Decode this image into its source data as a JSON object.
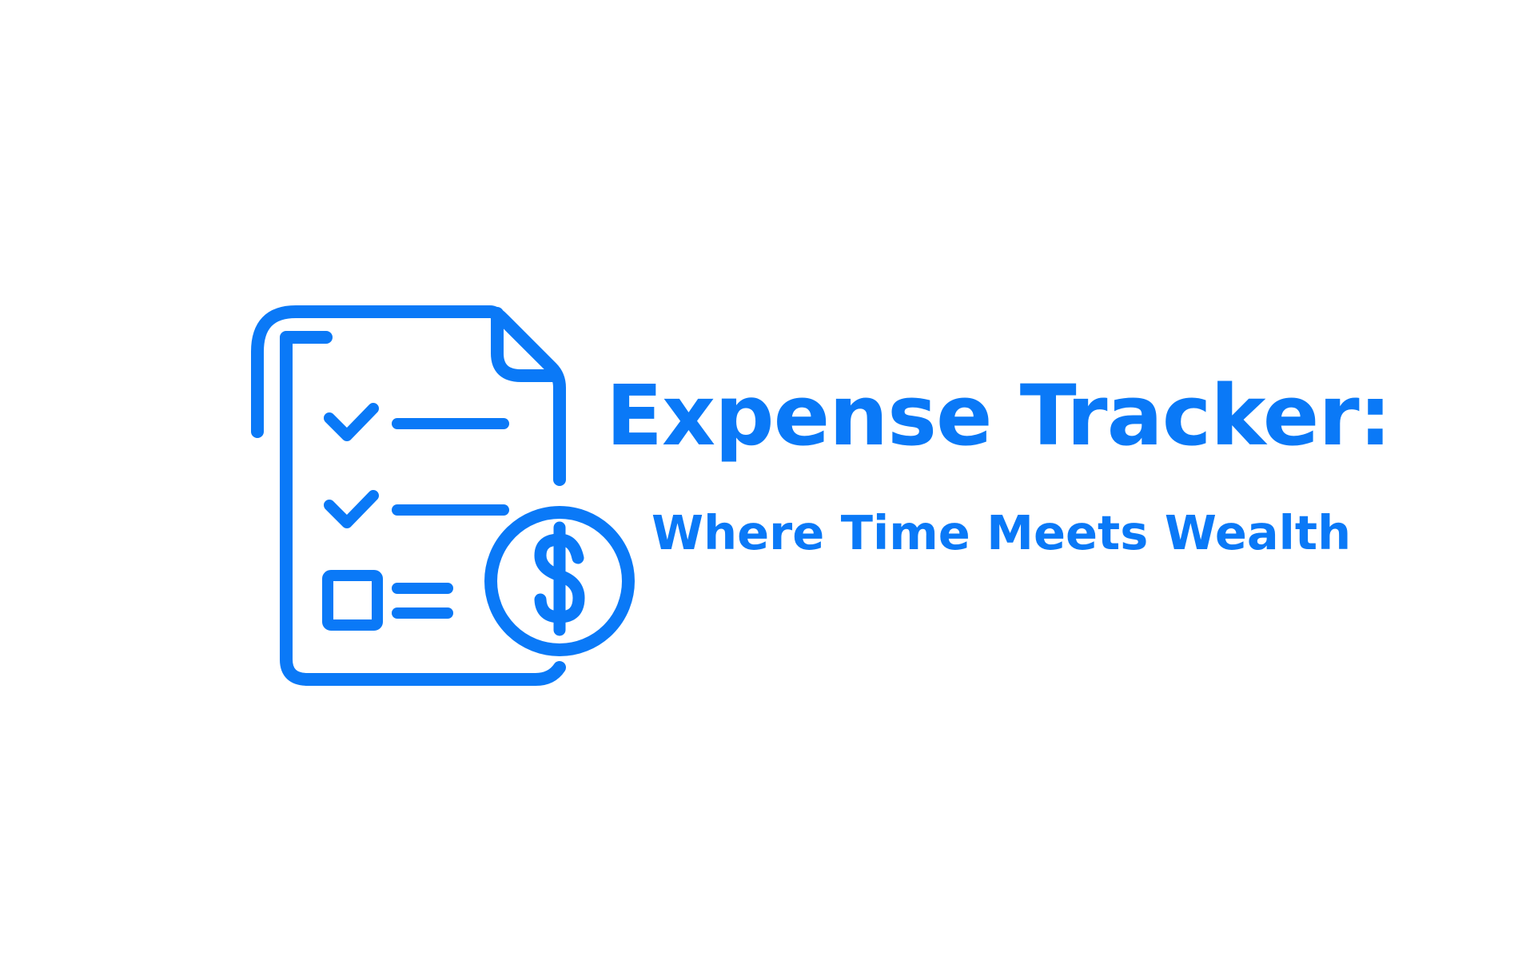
{
  "brand": {
    "title": "Expense Tracker:",
    "tagline": "Where Time Meets Wealth",
    "accent_color": "#0a79f7",
    "background_color": "#ffffff"
  },
  "icon": {
    "name": "expense-checklist-dollar-icon",
    "coin_symbol": "$"
  }
}
